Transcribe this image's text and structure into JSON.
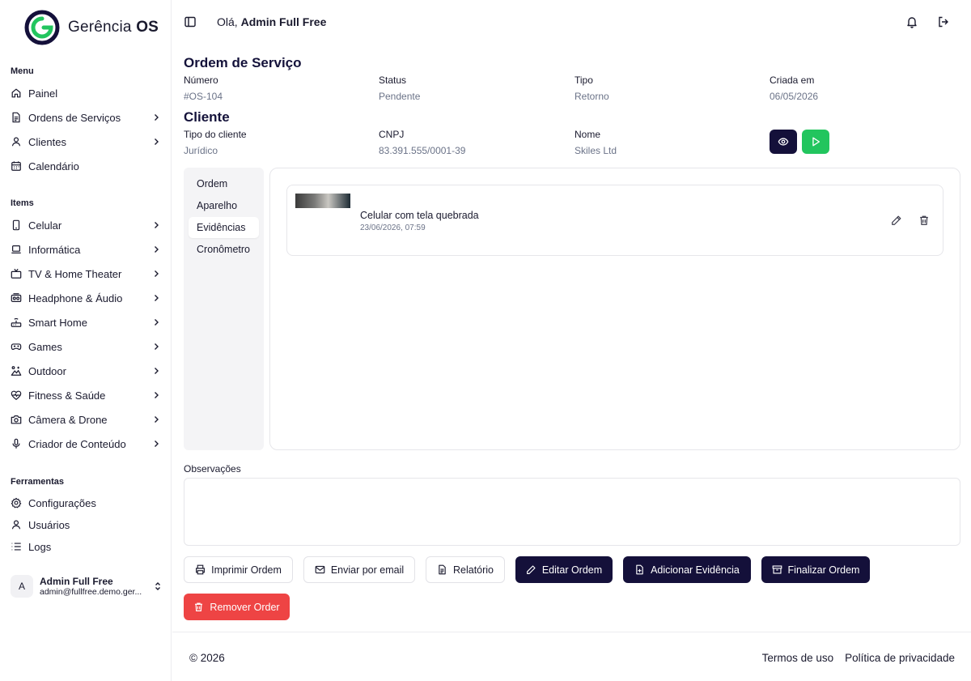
{
  "brand": {
    "name_light": "Gerência",
    "name_bold": "OS",
    "accent": "#22c55e",
    "primary": "#14103a",
    "danger": "#ee4444"
  },
  "sidebar": {
    "menu_label": "Menu",
    "menu": [
      {
        "label": "Painel",
        "icon": "home-icon",
        "chevron": false
      },
      {
        "label": "Ordens de Serviços",
        "icon": "document-icon",
        "chevron": true
      },
      {
        "label": "Clientes",
        "icon": "user-icon",
        "chevron": true
      },
      {
        "label": "Calendário",
        "icon": "calendar-icon",
        "chevron": false
      }
    ],
    "items_label": "Items",
    "items": [
      {
        "label": "Celular",
        "icon": "smartphone-icon"
      },
      {
        "label": "Informática",
        "icon": "laptop-icon"
      },
      {
        "label": "TV & Home Theater",
        "icon": "tv-icon"
      },
      {
        "label": "Headphone & Áudio",
        "icon": "speaker-icon"
      },
      {
        "label": "Smart Home",
        "icon": "router-icon"
      },
      {
        "label": "Games",
        "icon": "gamepad-icon"
      },
      {
        "label": "Outdoor",
        "icon": "outdoor-icon"
      },
      {
        "label": "Fitness & Saúde",
        "icon": "heart-pulse-icon"
      },
      {
        "label": "Câmera & Drone",
        "icon": "camera-icon"
      },
      {
        "label": "Criador de Conteúdo",
        "icon": "microphone-icon"
      }
    ],
    "tools_label": "Ferramentas",
    "tools": [
      {
        "label": "Configurações",
        "icon": "gear-icon"
      },
      {
        "label": "Usuários",
        "icon": "user-icon"
      },
      {
        "label": "Logs",
        "icon": "list-icon"
      }
    ],
    "user": {
      "initial": "A",
      "name": "Admin Full Free",
      "email": "admin@fullfree.demo.ger..."
    }
  },
  "header": {
    "greeting_prefix": "Olá, ",
    "user_name": "Admin Full Free"
  },
  "order": {
    "title": "Ordem de Serviço",
    "fields": [
      {
        "label": "Número",
        "value": "#OS-104"
      },
      {
        "label": "Status",
        "value": "Pendente"
      },
      {
        "label": "Tipo",
        "value": "Retorno"
      },
      {
        "label": "Criada em",
        "value": "06/05/2026"
      }
    ]
  },
  "client": {
    "title": "Cliente",
    "fields": [
      {
        "label": "Tipo do cliente",
        "value": "Jurídico"
      },
      {
        "label": "CNPJ",
        "value": "83.391.555/0001-39"
      },
      {
        "label": "Nome",
        "value": "Skiles Ltd"
      }
    ]
  },
  "tabs": [
    "Ordem",
    "Aparelho",
    "Evidências",
    "Cronômetro"
  ],
  "active_tab": "Evidências",
  "evidence": {
    "title": "Celular com tela quebrada",
    "date": "23/06/2026, 07:59"
  },
  "observations": {
    "label": "Observações",
    "value": ""
  },
  "actions": {
    "print": "Imprimir Ordem",
    "email": "Enviar por email",
    "report": "Relatório",
    "edit": "Editar Ordem",
    "add_evidence": "Adicionar Evidência",
    "finish": "Finalizar Ordem",
    "remove": "Remover Order"
  },
  "footer": {
    "copyright": "© 2026",
    "terms": "Termos de uso",
    "privacy": "Política de privacidade"
  }
}
